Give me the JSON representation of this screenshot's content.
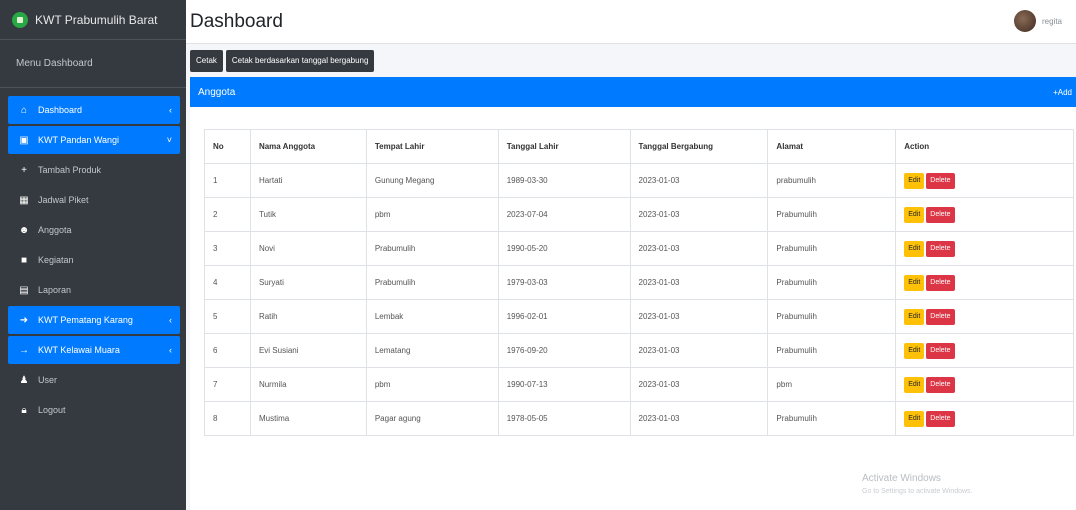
{
  "brand": {
    "title": "KWT Prabumulih Barat"
  },
  "sidebar": {
    "menu_header": "Menu Dashboard",
    "items": [
      {
        "label": "Dashboard",
        "icon": "home-icon",
        "active": true,
        "chevron": "‹"
      },
      {
        "label": "KWT Pandan Wangi",
        "icon": "users-group-icon",
        "active": true,
        "chevron": "˅"
      },
      {
        "label": "Tambah Produk",
        "icon": "plus-icon",
        "active": false
      },
      {
        "label": "Jadwal Piket",
        "icon": "table-icon",
        "active": false
      },
      {
        "label": "Anggota",
        "icon": "users-icon",
        "active": false
      },
      {
        "label": "Kegiatan",
        "icon": "briefcase-icon",
        "active": false
      },
      {
        "label": "Laporan",
        "icon": "chart-icon",
        "active": false
      },
      {
        "label": "KWT Pematang Karang",
        "icon": "arrow-icon",
        "active": true,
        "chevron": "‹"
      },
      {
        "label": "KWT Kelawai Muara",
        "icon": "arrow-icon",
        "active": true,
        "chevron": "‹"
      },
      {
        "label": "User",
        "icon": "user-icon",
        "active": false
      },
      {
        "label": "Logout",
        "icon": "lock-icon",
        "active": false
      }
    ]
  },
  "header": {
    "title": "Dashboard",
    "user_name": "regita"
  },
  "buttons": {
    "cetak": "Cetak",
    "cetak_tanggal": "Cetak berdasarkan tanggal bergabung"
  },
  "card": {
    "title": "Anggota",
    "add_label": "+Add"
  },
  "table": {
    "headers": [
      "No",
      "Nama Anggota",
      "Tempat Lahir",
      "Tanggal Lahir",
      "Tanggal Bergabung",
      "Alamat",
      "Action"
    ],
    "edit_label": "Edit",
    "delete_label": "Delete",
    "rows": [
      [
        "1",
        "Hartati",
        "Gunung Megang",
        "1989-03-30",
        "2023-01-03",
        "prabumulih"
      ],
      [
        "2",
        "Tutik",
        "pbm",
        "2023-07-04",
        "2023-01-03",
        "Prabumulih"
      ],
      [
        "3",
        "Novi",
        "Prabumulih",
        "1990-05-20",
        "2023-01-03",
        "Prabumulih"
      ],
      [
        "4",
        "Suryati",
        "Prabumulih",
        "1979-03-03",
        "2023-01-03",
        "Prabumulih"
      ],
      [
        "5",
        "Ratih",
        "Lembak",
        "1996-02-01",
        "2023-01-03",
        "Prabumulih"
      ],
      [
        "6",
        "Evi Susiani",
        "Lematang",
        "1976-09-20",
        "2023-01-03",
        "Prabumulih"
      ],
      [
        "7",
        "Nurmila",
        "pbm",
        "1990-07-13",
        "2023-01-03",
        "pbm"
      ],
      [
        "8",
        "Mustima",
        "Pagar agung",
        "1978-05-05",
        "2023-01-03",
        "Prabumulih"
      ]
    ]
  },
  "watermark": {
    "title": "Activate Windows",
    "subtitle": "Go to Settings to activate Windows."
  }
}
